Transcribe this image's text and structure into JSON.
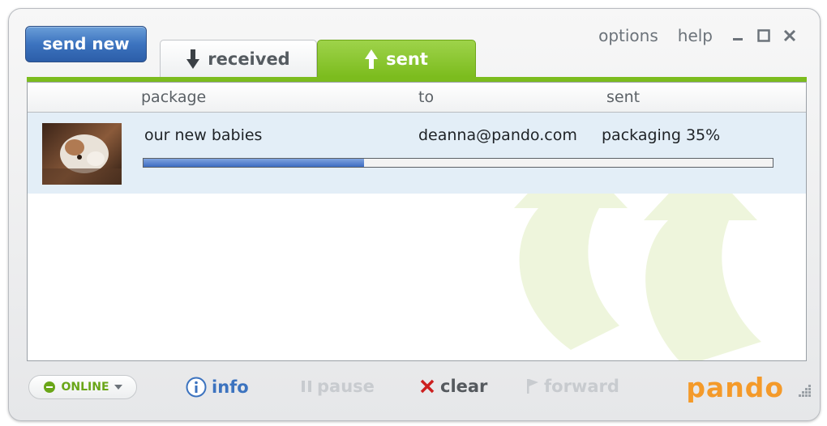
{
  "app": {
    "send_new_label": "send new",
    "tabs": [
      {
        "label": "received",
        "active": false
      },
      {
        "label": "sent",
        "active": true
      }
    ],
    "top_links": {
      "options": "options",
      "help": "help"
    }
  },
  "table": {
    "columns": {
      "package": "package",
      "to": "to",
      "sent": "sent"
    },
    "rows": [
      {
        "package": "our new babies",
        "to": "deanna@pando.com",
        "status": "packaging 35%",
        "progress_percent": 35
      }
    ]
  },
  "footer": {
    "status": "ONLINE",
    "info": "info",
    "pause": "pause",
    "clear": "clear",
    "forward": "forward",
    "logo": "pando"
  },
  "colors": {
    "accent_green": "#7cbc1e",
    "send_blue": "#3c73bf",
    "logo_orange": "#f49a2a",
    "clear_red": "#cc1f1f",
    "progress_blue": "#3c6cc2"
  }
}
